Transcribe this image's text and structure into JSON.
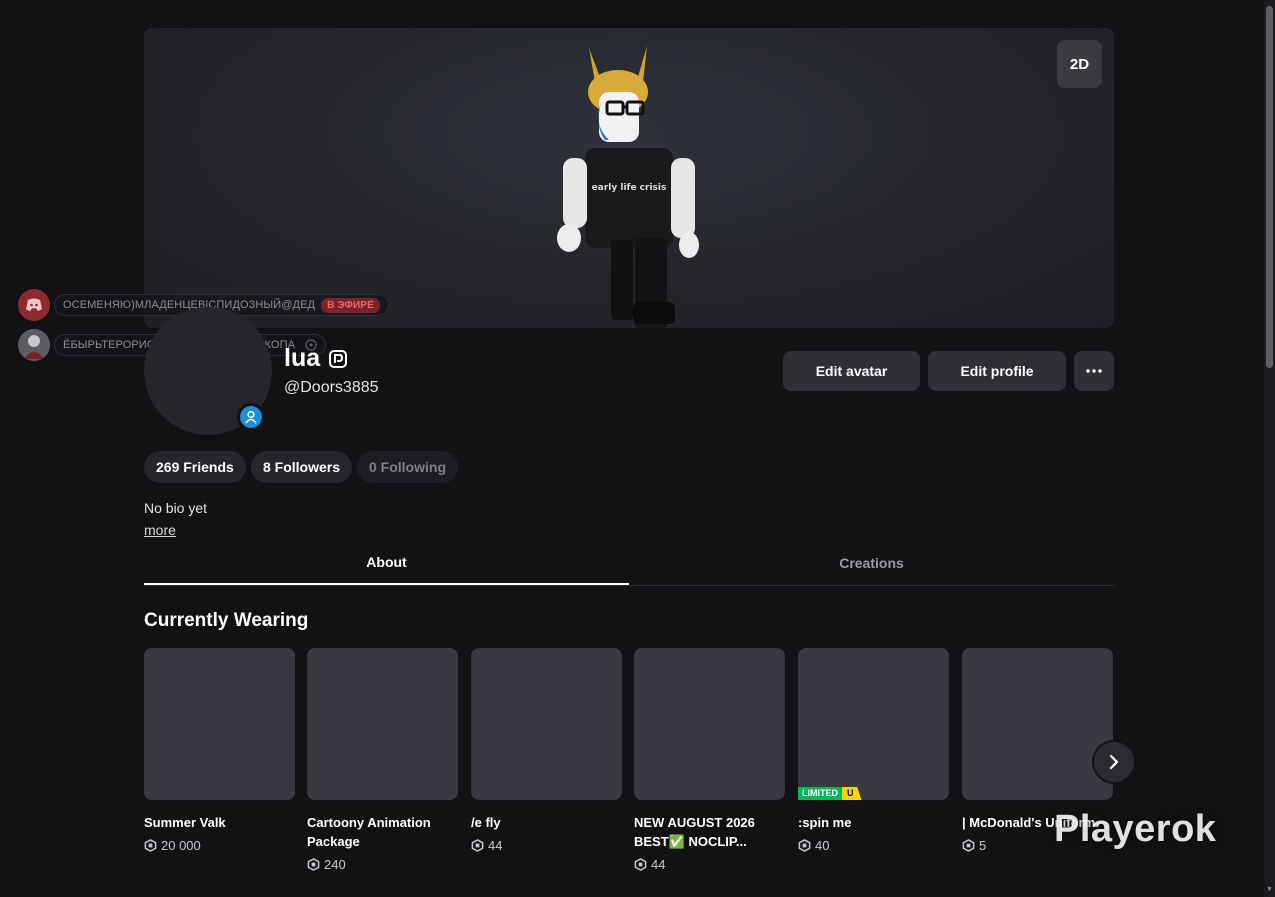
{
  "banner": {
    "toggle_label": "2D",
    "shirt_text": "early life crisis"
  },
  "overlay": {
    "rows": [
      {
        "icon": "discord-icon",
        "text": "ОСЕМЕНЯЮ)МЛАДЕНЦЕВ|СПИДОЗНЫЙ@ДЕД",
        "badge": "В ЭФИРЕ"
      },
      {
        "icon": "user-avatar",
        "text": "ЁБЫРЬТЕРОРИСТ228 КИЛЕР ПРОЗБЖОПА"
      }
    ]
  },
  "profile": {
    "display_name": "lua",
    "username": "@Doors3885",
    "bio": "No bio yet",
    "bio_more": "more"
  },
  "actions": {
    "edit_avatar": "Edit avatar",
    "edit_profile": "Edit profile"
  },
  "stats": {
    "friends": "269 Friends",
    "followers": "8 Followers",
    "following": "0 Following"
  },
  "tabs": [
    {
      "label": "About",
      "active": true
    },
    {
      "label": "Creations",
      "active": false
    }
  ],
  "wearing": {
    "title": "Currently Wearing",
    "items": [
      {
        "name": "Summer Valk",
        "price": "20 000"
      },
      {
        "name": "Cartoony Animation Package",
        "price": "240"
      },
      {
        "name": "/e fly",
        "price": "44"
      },
      {
        "name": "NEW AUGUST 2026 BEST✅ NOCLIP...",
        "price": "44"
      },
      {
        "name": ":spin me",
        "price": "40",
        "limited": "LIMITED",
        "limited_u": "U"
      },
      {
        "name": "| McDonald's Uniform",
        "price": "5"
      }
    ]
  },
  "watermark": "Playerok",
  "colors": {
    "background": "#121215",
    "card": "#393a41",
    "button": "#2e3036",
    "presence": "#1c8fd9",
    "limited_green": "#02b757",
    "limited_yellow": "#f5d400"
  }
}
